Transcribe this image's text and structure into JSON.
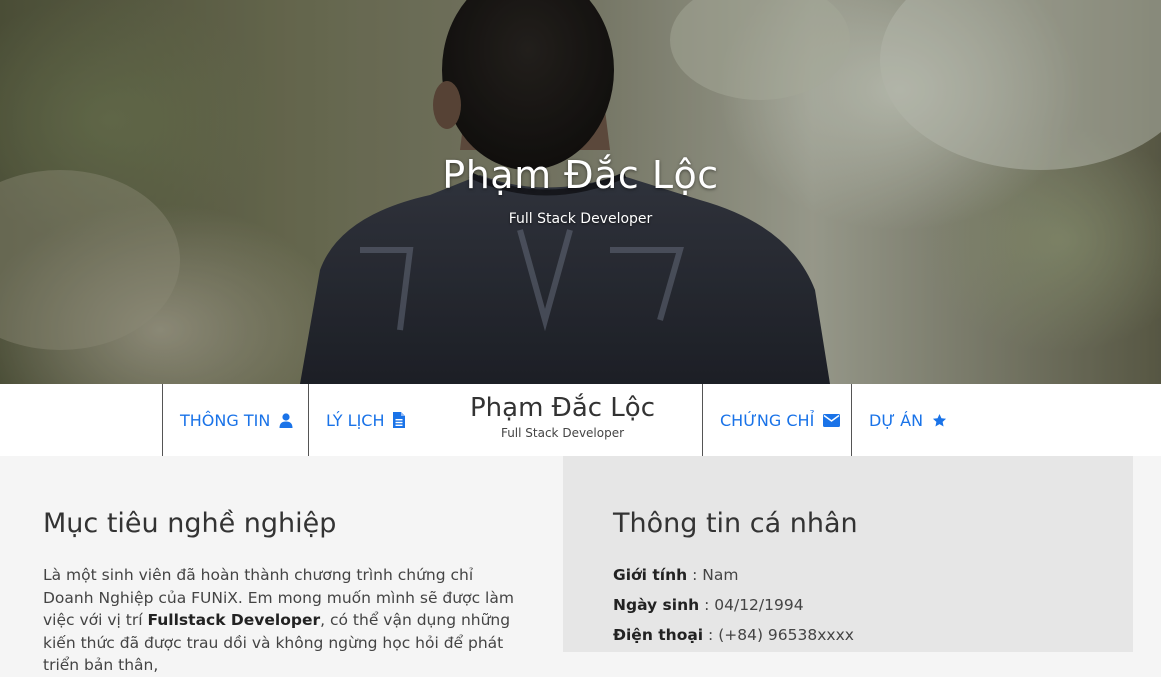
{
  "hero": {
    "name": "Phạm Đắc Lộc",
    "role": "Full Stack Developer"
  },
  "nav": {
    "items": [
      {
        "label": "THÔNG TIN",
        "icon": "user-icon"
      },
      {
        "label": "LÝ LỊCH",
        "icon": "file-icon"
      },
      {
        "label": "CHỨNG CHỈ",
        "icon": "envelope-icon"
      },
      {
        "label": "DỰ ÁN",
        "icon": "star-icon"
      }
    ],
    "brand_name": "Phạm Đắc Lộc",
    "brand_role": "Full Stack Developer",
    "accent": "#1a73e8"
  },
  "objective": {
    "title": "Mục tiêu nghề nghiệp",
    "text_1": "Là một sinh viên đã hoàn thành chương trình chứng chỉ Doanh Nghiệp của FUNiX. Em mong muốn mình sẽ được làm việc với vị trí ",
    "highlight": "Fullstack Developer",
    "text_2": ", có thể vận dụng những kiến thức đã được trau dồi và không ngừng học hỏi để phát triển bản thân,"
  },
  "personal": {
    "title": "Thông tin cá nhân",
    "rows": [
      {
        "label": "Giới tính",
        "value": "Nam"
      },
      {
        "label": "Ngày sinh",
        "value": "04/12/1994"
      },
      {
        "label": "Điện thoại",
        "value": "(+84) 96538xxxx"
      }
    ]
  }
}
